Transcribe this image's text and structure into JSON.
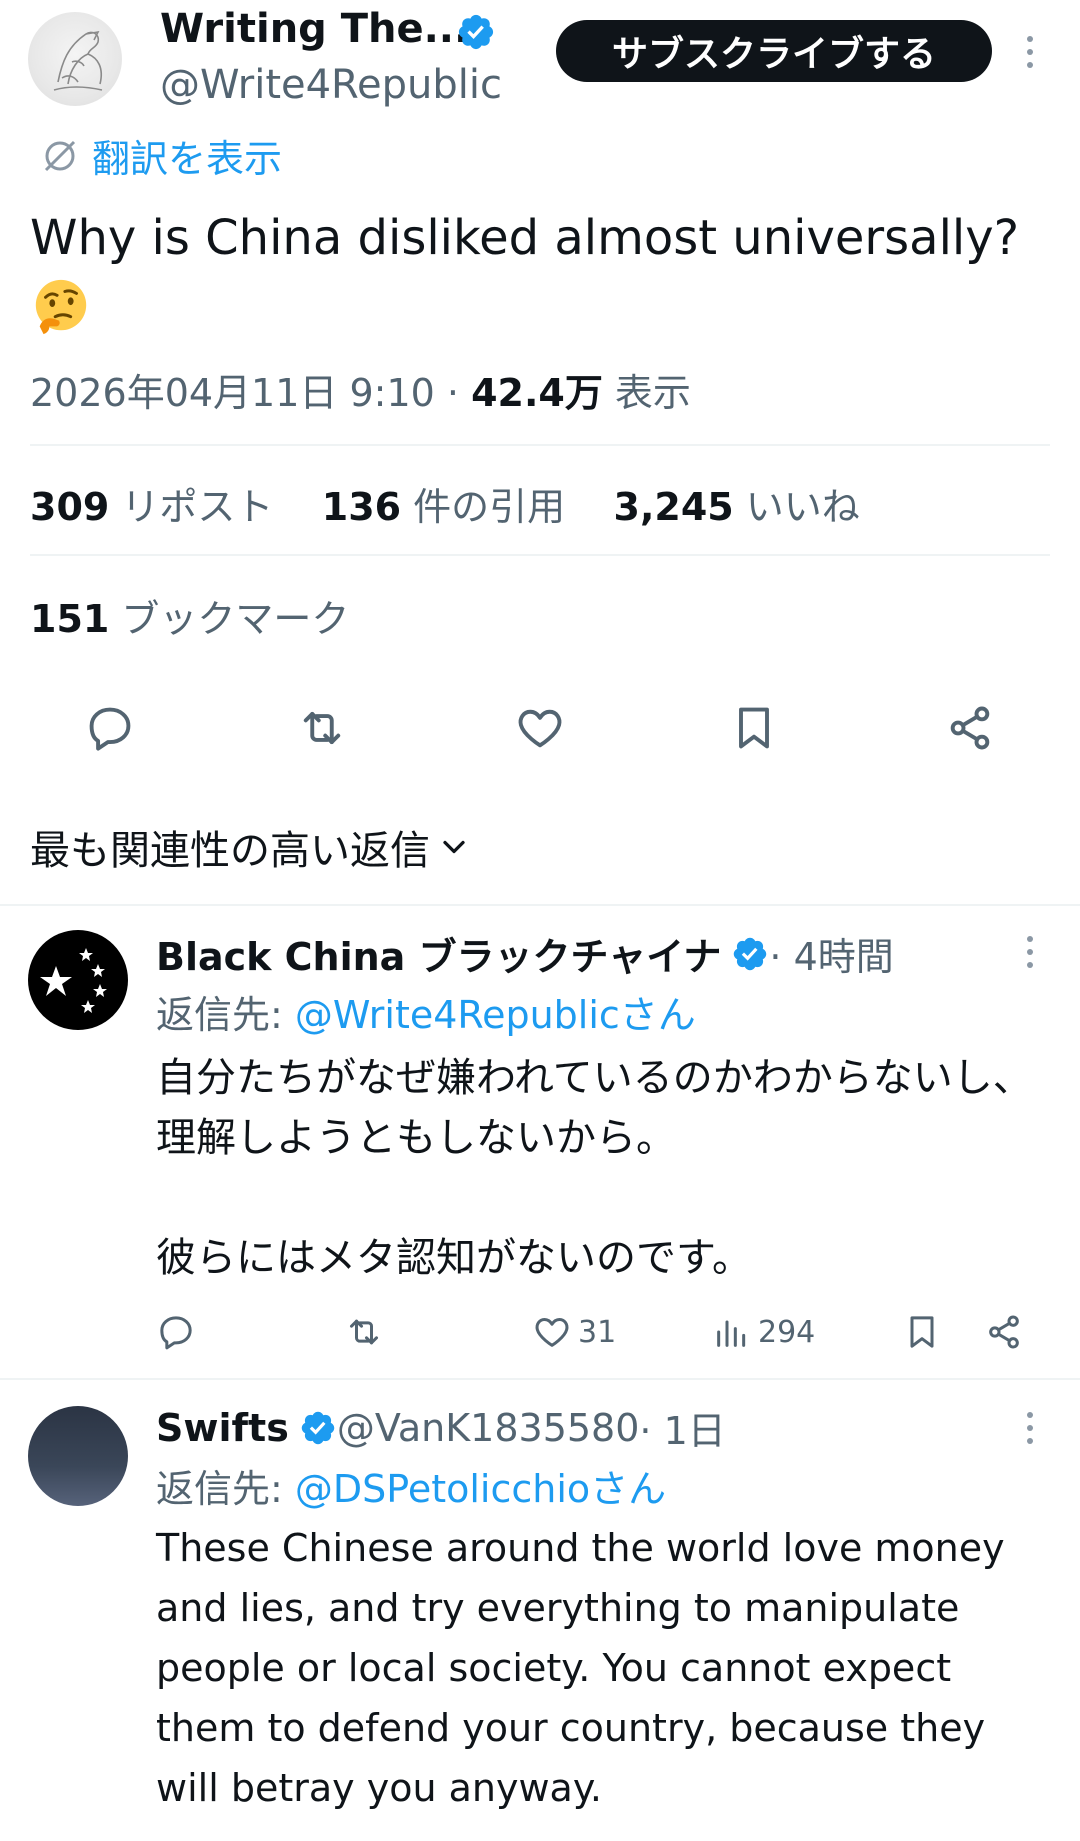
{
  "tweet": {
    "author_name": "Writing The...",
    "author_handle": "@Write4Republic",
    "subscribe_label": "サブスクライブする",
    "translate_label": "翻訳を表示",
    "text": "Why is China disliked almost universally?",
    "emoji": "thinking-face",
    "timestamp": "2026年04月11日 9:10 · ",
    "views_count": "42.4万",
    "views_label": " 表示"
  },
  "stats": {
    "reposts_count": "309",
    "reposts_label": " リポスト",
    "quotes_count": "136",
    "quotes_label": " 件の引用",
    "likes_count": "3,245",
    "likes_label": " いいね",
    "bookmarks_count": "151",
    "bookmarks_label": " ブックマーク"
  },
  "actions": [
    "reply-icon",
    "repost-icon",
    "like-icon",
    "bookmark-icon",
    "share-icon"
  ],
  "sort": {
    "label": "最も関連性の高い返信"
  },
  "replies": [
    {
      "name": "Black China ブラックチャイナ",
      "handle": "",
      "time": " · 4時間",
      "reply_to_prefix": "返信先: ",
      "reply_to_mention": "@Write4Republicさん",
      "body": "自分たちがなぜ嫌われているのかわからないし、理解しようともしないから。\n\n彼らにはメタ認知がないのです。",
      "likes": "31",
      "views": "294"
    },
    {
      "name": "Swifts",
      "handle": " @VanK1835580",
      "time": " · 1日",
      "reply_to_prefix": "返信先: ",
      "reply_to_mention": "@DSPetolicchioさん",
      "body": "These Chinese around the world love money and lies, and try everything to manipulate people or local society. You cannot expect them to defend your country, because they will betray you anyway."
    }
  ],
  "colors": {
    "accent": "#1d9bf0",
    "text": "#0f1419",
    "secondary": "#536471",
    "divider": "#eff3f4"
  }
}
